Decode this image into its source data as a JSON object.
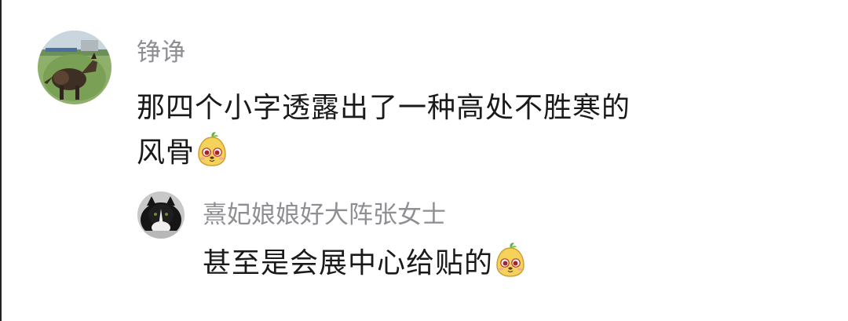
{
  "comments": [
    {
      "avatar_icon": "dog-on-grass-avatar",
      "username": "铮诤",
      "text_line1": "那四个小字透露出了一种高处不胜寒的",
      "text_line2": "风骨",
      "emoji_icon": "yellow-character-emoji"
    },
    {
      "avatar_icon": "black-white-cat-avatar",
      "username": "熹妃娘娘好大阵张女士",
      "text": "甚至是会展中心给贴的",
      "emoji_icon": "yellow-character-emoji"
    }
  ]
}
